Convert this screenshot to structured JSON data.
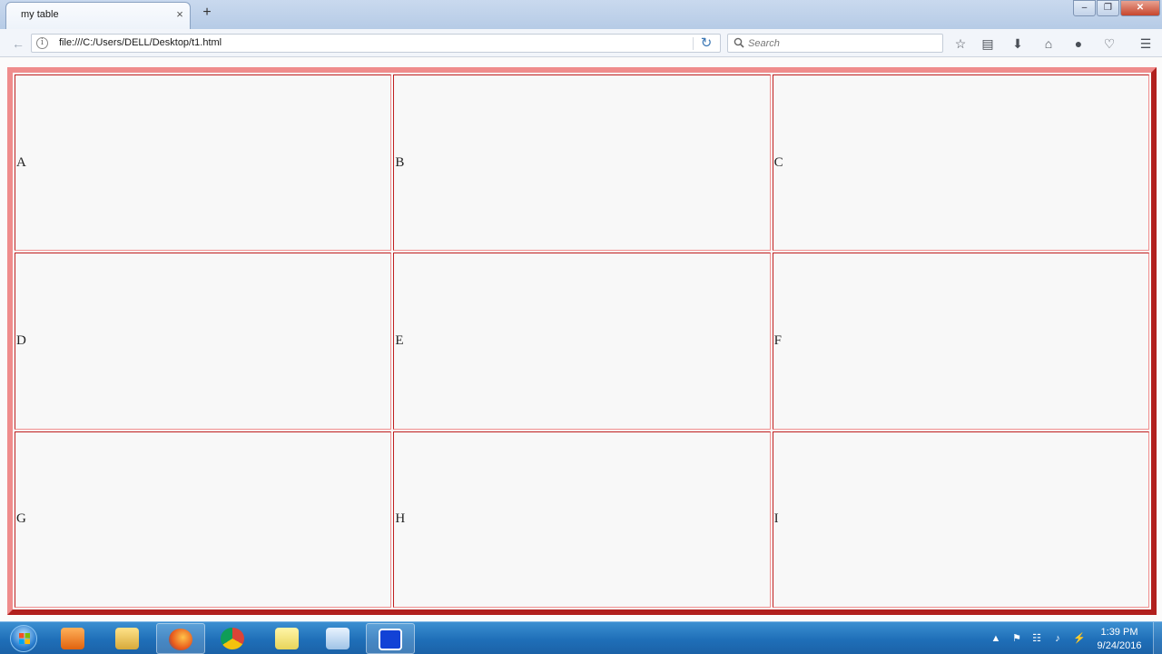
{
  "browser": {
    "tab_title": "my table",
    "tab_close": "×",
    "new_tab": "+",
    "url": "file:///C:/Users/DELL/Desktop/t1.html",
    "search_placeholder": "Search",
    "window_controls": {
      "minimize": "–",
      "restore": "❐",
      "close": "✕"
    }
  },
  "toolbar_icons": [
    "star-icon",
    "reading-list-icon",
    "download-icon",
    "home-icon",
    "chat-icon",
    "pocket-icon",
    "menu-icon"
  ],
  "table": {
    "rows": [
      [
        "A",
        "B",
        "C"
      ],
      [
        "D",
        "E",
        "F"
      ],
      [
        "G",
        "H",
        "I"
      ]
    ],
    "outer_border_light": "#ef8c8c",
    "outer_border_dark": "#b1201e"
  },
  "taskbar": {
    "time": "1:39 PM",
    "date": "9/24/2016",
    "apps": [
      "media-player-icon",
      "file-explorer-icon",
      "firefox-icon",
      "chrome-icon",
      "sticky-notes-icon",
      "notepad-icon",
      "teamviewer-icon"
    ]
  }
}
